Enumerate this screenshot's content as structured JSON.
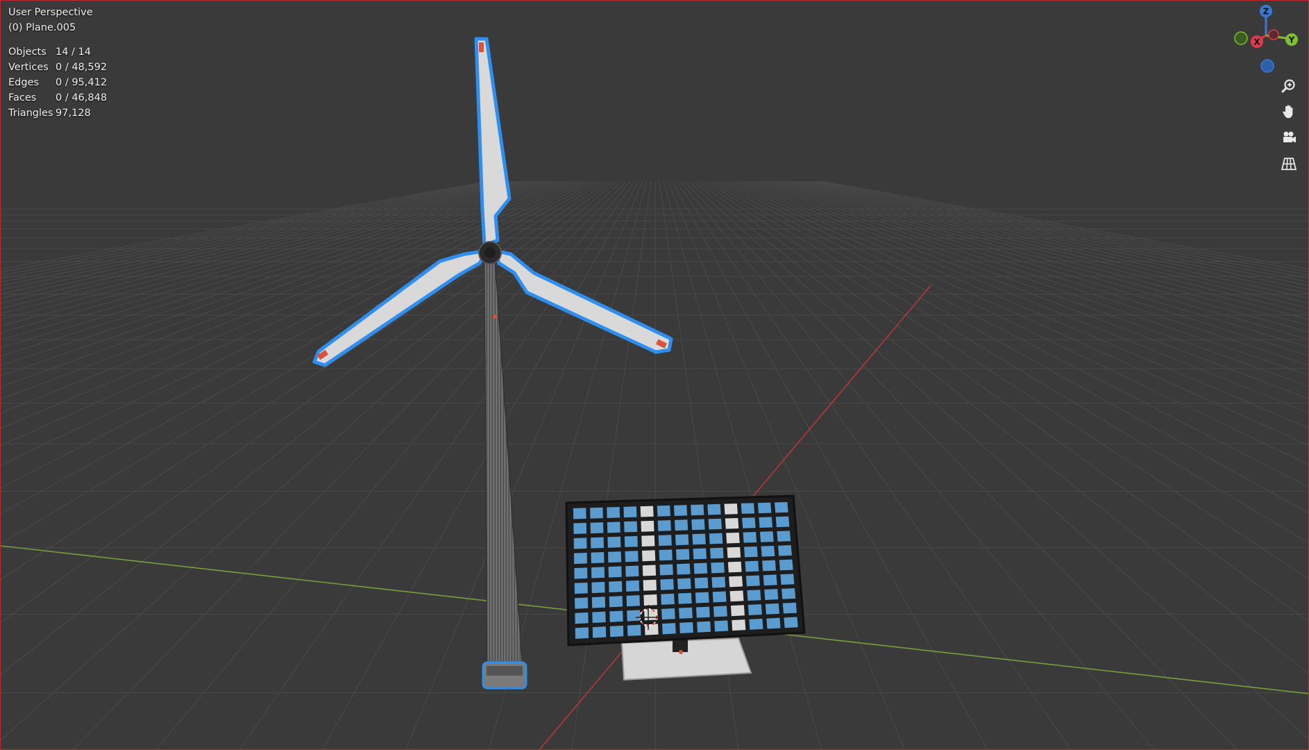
{
  "viewport": {
    "view_name": "User Perspective",
    "active_object": "(0) Plane.005"
  },
  "stats": [
    {
      "label": "Objects",
      "value": "14 / 14"
    },
    {
      "label": "Vertices",
      "value": "0 / 48,592"
    },
    {
      "label": "Edges",
      "value": "0 / 95,412"
    },
    {
      "label": "Faces",
      "value": "0 / 46,848"
    },
    {
      "label": "Triangles",
      "value": "97,128"
    }
  ],
  "gizmo": {
    "z_label": "Z",
    "x_label": "X",
    "y_label": "Y",
    "colors": {
      "x": "#e03a4f",
      "y": "#7fbf32",
      "z": "#3a78d8"
    }
  },
  "nav_icons": [
    "zoom-icon",
    "hand-pan-icon",
    "camera-icon",
    "grid-ortho-icon"
  ],
  "colors": {
    "background": "#3a3a3a",
    "grid": "#4a4a4a",
    "x_axis": "#c03a3a",
    "y_axis": "#7aa43a",
    "selection_outline": "#2f8ff0",
    "solar_cell": "#5a9bd0"
  }
}
